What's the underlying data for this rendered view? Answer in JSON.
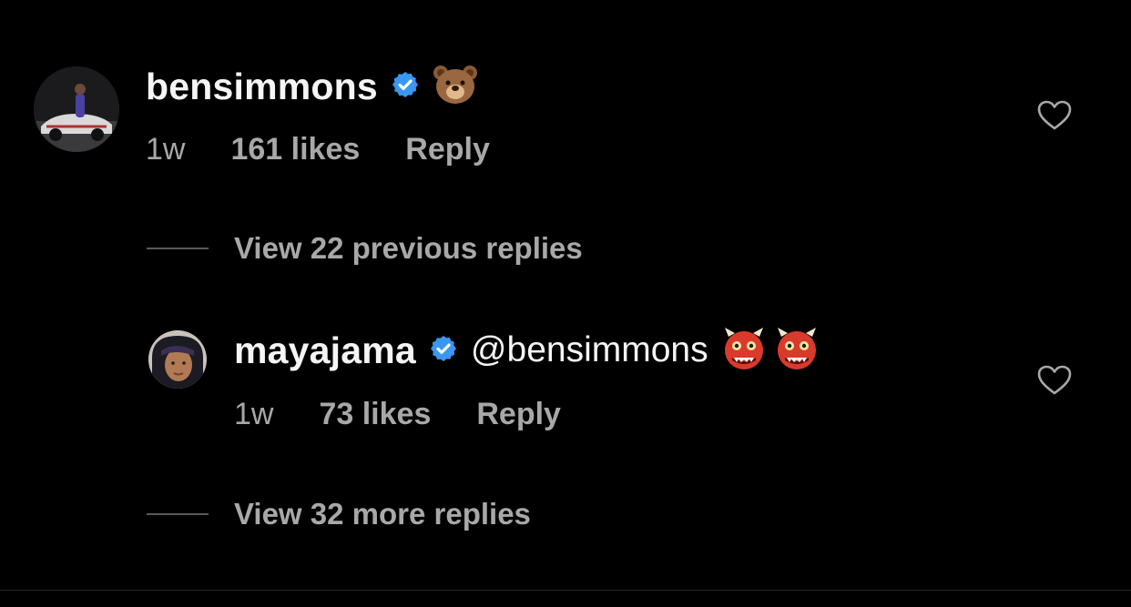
{
  "colors": {
    "background": "#000000",
    "text_primary": "#f5f5f5",
    "text_secondary": "#a8a8a8",
    "verified_badge": "#3897f0"
  },
  "comments": [
    {
      "username": "bensimmons",
      "verified": true,
      "text": "",
      "emoji_icons": [
        "bear-emoji"
      ],
      "time": "1w",
      "likes": "161 likes",
      "reply_label": "Reply",
      "like_icon": "heart-outline-icon"
    },
    {
      "username": "mayajama",
      "verified": true,
      "text": "@bensimmons",
      "emoji_icons": [
        "ogre-emoji",
        "ogre-emoji"
      ],
      "time": "1w",
      "likes": "73 likes",
      "reply_label": "Reply",
      "like_icon": "heart-outline-icon"
    }
  ],
  "threads": [
    {
      "label": "View 22 previous replies"
    },
    {
      "label": "View 32 more replies"
    }
  ]
}
